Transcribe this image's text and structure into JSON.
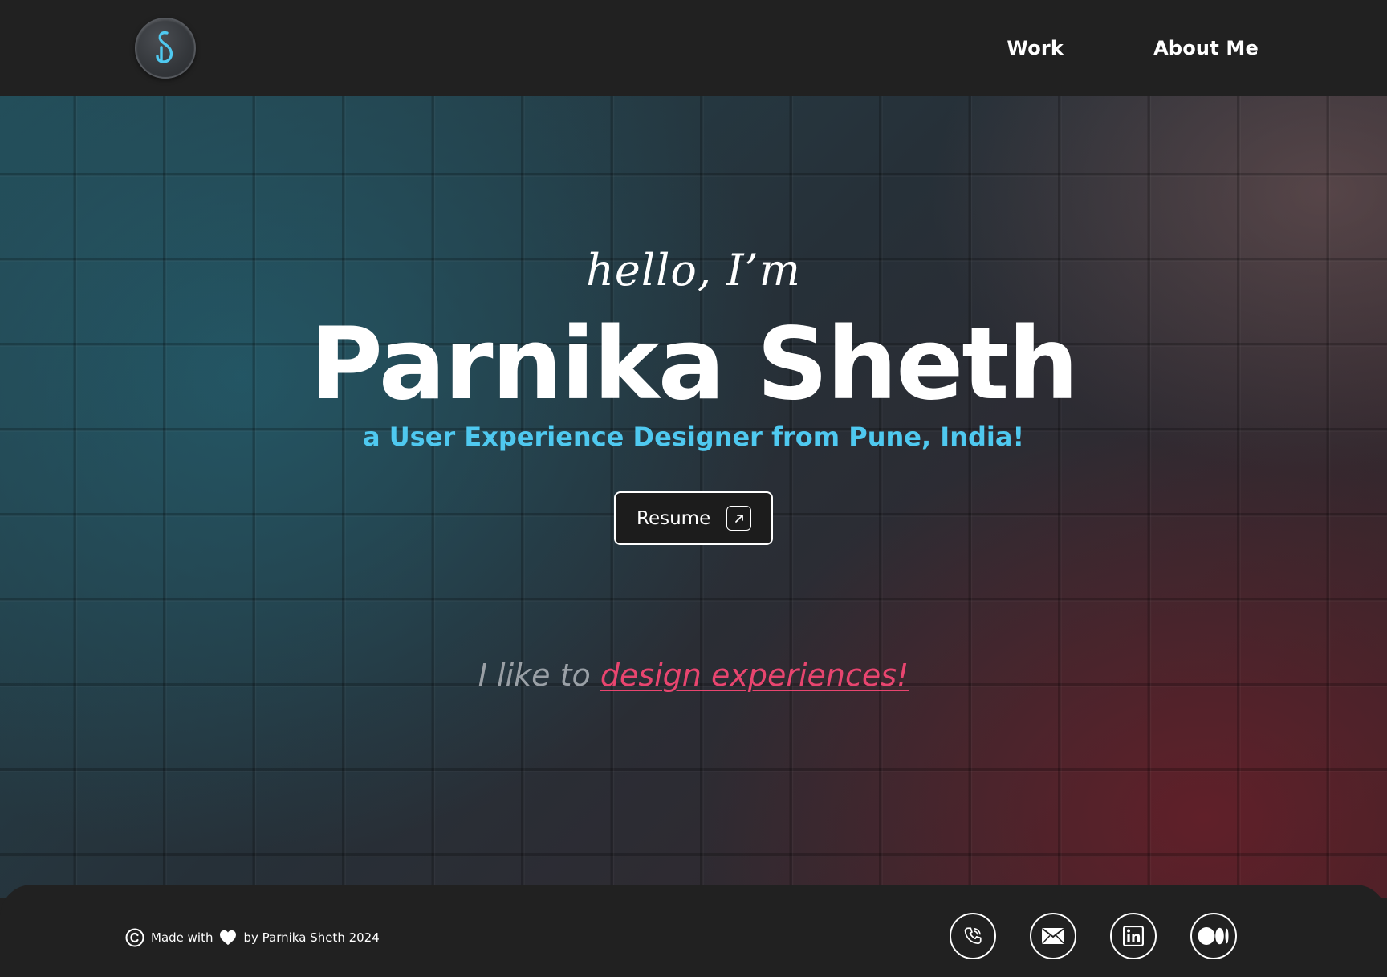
{
  "header": {
    "logo_letter": "S",
    "nav": [
      {
        "label": "Work"
      },
      {
        "label": "About Me"
      }
    ]
  },
  "hero": {
    "greeting": "hello, I’m",
    "name": "Parnika Sheth",
    "tagline": "a User Experience Designer from Pune, India!",
    "resume_label": "Resume",
    "like_prefix": "I like to ",
    "like_highlight": "design experiences!"
  },
  "footer": {
    "made_with": "Made with",
    "by_line": "by Parnika Sheth 2024",
    "socials": [
      "phone-icon",
      "mail-icon",
      "linkedin-icon",
      "medium-icon"
    ]
  },
  "colors": {
    "accent_blue": "#4fc9f0",
    "accent_pink": "#e8456f",
    "bar_bg": "#212121"
  }
}
